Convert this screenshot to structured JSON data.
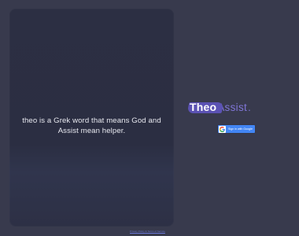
{
  "panel": {
    "text": "theo is a Grek word that means God and Assist mean helper."
  },
  "brand": {
    "part1": "Theo",
    "part2": "Assist",
    "dot": "."
  },
  "auth": {
    "google_label": "Sign in with Google",
    "icon": "google-icon"
  },
  "footer": {
    "link": "Privacy Policy & Terms of Service"
  },
  "colors": {
    "background": "#383a4d",
    "panel": "#2c2f43",
    "brand_accent": "#7f75d6",
    "google_blue": "#4285f4"
  }
}
